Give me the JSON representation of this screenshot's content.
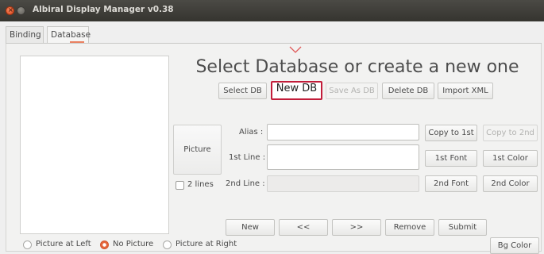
{
  "window": {
    "title": "Albiral Display Manager v0.38"
  },
  "tabs": [
    {
      "label": "Binding"
    },
    {
      "label": "Database"
    }
  ],
  "main": {
    "headline": "Select Database or create a new one",
    "db_buttons": {
      "select": "Select DB",
      "new": "New DB",
      "save_as": "Save As DB",
      "delete": "Delete DB",
      "import_xml": "Import XML"
    },
    "picture_button": "Picture",
    "two_lines": "2 lines",
    "alias_label": "Alias :",
    "first_line_label": "1st Line :",
    "second_line_label": "2nd Line :",
    "copy_to_1st": "Copy to 1st",
    "copy_to_2nd": "Copy to 2nd",
    "first_font": "1st Font",
    "first_color": "1st Color",
    "second_font": "2nd Font",
    "second_color": "2nd Color",
    "nav": {
      "new": "New",
      "prev": "<<",
      "next": ">>",
      "remove": "Remove",
      "submit": "Submit"
    }
  },
  "picture_position": {
    "options": [
      "Picture at Left",
      "No Picture",
      "Picture at Right"
    ],
    "selected": "No Picture"
  },
  "bg_color_button": "Bg Color",
  "colors": {
    "highlight_border": "#c21d3a",
    "radio_selected": "#e5663c",
    "caret": "#e05a5a"
  }
}
